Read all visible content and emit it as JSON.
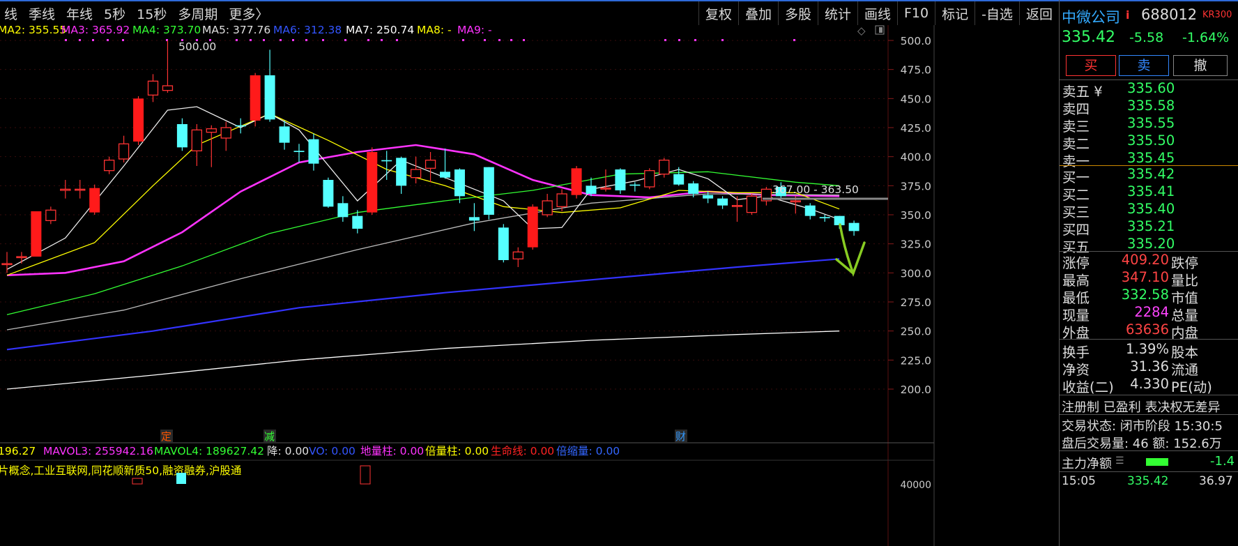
{
  "left_tabs": [
    "线",
    "季线",
    "年线",
    "5秒",
    "15秒",
    "多周期",
    "更多〉"
  ],
  "toolbar": [
    "复权",
    "叠加",
    "多股",
    "统计",
    "画线",
    "F10",
    "标记",
    "-自选",
    "返回"
  ],
  "ma_legend": [
    {
      "text": "MA2: 355.55",
      "color": "#ffff00"
    },
    {
      "text": "MA3: 365.92",
      "color": "#ff33ff"
    },
    {
      "text": "MA4: 373.70",
      "color": "#33ff33"
    },
    {
      "text": "MA5: 377.76",
      "color": "#e0e0e0"
    },
    {
      "text": "MA6: 312.38",
      "color": "#3355ff"
    },
    {
      "text": "MA7: 250.74",
      "color": "#ffffff"
    },
    {
      "text": "MA8: -",
      "color": "#ffff00"
    },
    {
      "text": "MA9: -",
      "color": "#ff33ff"
    }
  ],
  "y_ticks": [
    "500.0",
    "475.0",
    "450.0",
    "425.0",
    "400.0",
    "375.0",
    "350.0",
    "325.0",
    "300.0",
    "275.0",
    "250.0",
    "225.0",
    "200.0"
  ],
  "high_label": "500.00",
  "range_label": "367.00 - 363.50",
  "event_markers": [
    {
      "text": "定",
      "color": "#ff5500"
    },
    {
      "text": "减",
      "color": "#33ff33"
    },
    {
      "text": "财",
      "color": "#3399ff"
    }
  ],
  "vol_legend": [
    {
      "text": "196.27",
      "color": "#ffff00"
    },
    {
      "text": "MAVOL3: 255942.16",
      "color": "#ff33ff"
    },
    {
      "text": "MAVOL4: 189627.42",
      "color": "#33ff33"
    },
    {
      "text": "降: 0.00",
      "color": "#e0e0e0"
    },
    {
      "text": "VO: 0.00",
      "color": "#3355ff"
    },
    {
      "text": "地量柱: 0.00",
      "color": "#ff33ff"
    },
    {
      "text": "倍量柱: 0.00",
      "color": "#ffff00"
    },
    {
      "text": "生命线: 0.00",
      "color": "#ff2222"
    },
    {
      "text": "倍缩量: 0.00",
      "color": "#3366ff"
    }
  ],
  "concepts": "片概念,工业互联网,同花顺新质50,融资融券,沪股通",
  "vol_axis_label": "40000",
  "chart_data": {
    "type": "candlestick",
    "ylim": [
      200,
      500
    ],
    "candles": [
      {
        "o": 308,
        "c": 308,
        "h": 318,
        "l": 300
      },
      {
        "o": 314,
        "c": 314,
        "h": 318,
        "l": 308
      },
      {
        "o": 314,
        "c": 353,
        "h": 353,
        "l": 314
      },
      {
        "o": 345,
        "c": 354,
        "h": 357,
        "l": 342
      },
      {
        "o": 371,
        "c": 372,
        "h": 380,
        "l": 364
      },
      {
        "o": 372,
        "c": 372,
        "h": 380,
        "l": 364
      },
      {
        "o": 352,
        "c": 373,
        "h": 376,
        "l": 350
      },
      {
        "o": 388,
        "c": 397,
        "h": 400,
        "l": 385
      },
      {
        "o": 398,
        "c": 411,
        "h": 418,
        "l": 395
      },
      {
        "o": 413,
        "c": 450,
        "h": 452,
        "l": 410
      },
      {
        "o": 453,
        "c": 465,
        "h": 471,
        "l": 447
      },
      {
        "o": 457,
        "c": 461,
        "h": 500,
        "l": 455
      },
      {
        "o": 428,
        "c": 408,
        "h": 433,
        "l": 405
      },
      {
        "o": 405,
        "c": 423,
        "h": 428,
        "l": 392
      },
      {
        "o": 421,
        "c": 424,
        "h": 427,
        "l": 391
      },
      {
        "o": 416,
        "c": 425,
        "h": 430,
        "l": 405
      },
      {
        "o": 427,
        "c": 426,
        "h": 433,
        "l": 420
      },
      {
        "o": 431,
        "c": 470,
        "h": 472,
        "l": 426
      },
      {
        "o": 470,
        "c": 432,
        "h": 492,
        "l": 430
      },
      {
        "o": 426,
        "c": 412,
        "h": 431,
        "l": 406
      },
      {
        "o": 405,
        "c": 404,
        "h": 411,
        "l": 395
      },
      {
        "o": 415,
        "c": 394,
        "h": 420,
        "l": 388
      },
      {
        "o": 380,
        "c": 357,
        "h": 382,
        "l": 356
      },
      {
        "o": 360,
        "c": 348,
        "h": 366,
        "l": 344
      },
      {
        "o": 349,
        "c": 338,
        "h": 354,
        "l": 334
      },
      {
        "o": 352,
        "c": 404,
        "h": 408,
        "l": 350
      },
      {
        "o": 397,
        "c": 396,
        "h": 405,
        "l": 380
      },
      {
        "o": 399,
        "c": 375,
        "h": 400,
        "l": 368
      },
      {
        "o": 382,
        "c": 389,
        "h": 400,
        "l": 377
      },
      {
        "o": 390,
        "c": 397,
        "h": 404,
        "l": 378
      },
      {
        "o": 387,
        "c": 382,
        "h": 407,
        "l": 381
      },
      {
        "o": 389,
        "c": 366,
        "h": 390,
        "l": 360
      },
      {
        "o": 348,
        "c": 345,
        "h": 360,
        "l": 336
      },
      {
        "o": 391,
        "c": 350,
        "h": 391,
        "l": 346
      },
      {
        "o": 339,
        "c": 311,
        "h": 342,
        "l": 309
      },
      {
        "o": 312,
        "c": 318,
        "h": 322,
        "l": 305
      },
      {
        "o": 322,
        "c": 357,
        "h": 359,
        "l": 320
      },
      {
        "o": 350,
        "c": 362,
        "h": 368,
        "l": 348
      },
      {
        "o": 357,
        "c": 368,
        "h": 372,
        "l": 353
      },
      {
        "o": 367,
        "c": 390,
        "h": 392,
        "l": 364
      },
      {
        "o": 375,
        "c": 368,
        "h": 382,
        "l": 366
      },
      {
        "o": 373,
        "c": 373,
        "h": 389,
        "l": 370
      },
      {
        "o": 389,
        "c": 371,
        "h": 390,
        "l": 368
      },
      {
        "o": 376,
        "c": 375,
        "h": 378,
        "l": 370
      },
      {
        "o": 374,
        "c": 388,
        "h": 390,
        "l": 372
      },
      {
        "o": 385,
        "c": 397,
        "h": 399,
        "l": 382
      },
      {
        "o": 385,
        "c": 376,
        "h": 391,
        "l": 375
      },
      {
        "o": 377,
        "c": 368,
        "h": 379,
        "l": 365
      },
      {
        "o": 367,
        "c": 364,
        "h": 370,
        "l": 360
      },
      {
        "o": 364,
        "c": 358,
        "h": 366,
        "l": 355
      },
      {
        "o": 358,
        "c": 358,
        "h": 366,
        "l": 344
      },
      {
        "o": 352,
        "c": 366,
        "h": 368,
        "l": 350
      },
      {
        "o": 362,
        "c": 372,
        "h": 374,
        "l": 358
      },
      {
        "o": 374,
        "c": 366,
        "h": 378,
        "l": 364
      },
      {
        "o": 362,
        "c": 362,
        "h": 366,
        "l": 351
      },
      {
        "o": 358,
        "c": 349,
        "h": 360,
        "l": 346
      },
      {
        "o": 348,
        "c": 347,
        "h": 350,
        "l": 344
      },
      {
        "o": 349,
        "c": 341,
        "h": 349,
        "l": 338
      },
      {
        "o": 343,
        "c": 336,
        "h": 345,
        "l": 332
      }
    ],
    "ma_lines": [
      {
        "name": "MA6",
        "color": "#3333ff",
        "values": [
          [
            0,
            234
          ],
          [
            10,
            250
          ],
          [
            20,
            270
          ],
          [
            30,
            283
          ],
          [
            40,
            294
          ],
          [
            50,
            305
          ],
          [
            57,
            312
          ]
        ]
      },
      {
        "name": "MA7",
        "color": "#ffffff",
        "values": [
          [
            0,
            200
          ],
          [
            10,
            212
          ],
          [
            20,
            225
          ],
          [
            30,
            235
          ],
          [
            40,
            242
          ],
          [
            50,
            247
          ],
          [
            57,
            250
          ]
        ]
      },
      {
        "name": "MA3",
        "color": "#ff33ff",
        "values": [
          [
            0,
            298
          ],
          [
            4,
            300
          ],
          [
            8,
            310
          ],
          [
            12,
            335
          ],
          [
            16,
            370
          ],
          [
            20,
            395
          ],
          [
            24,
            404
          ],
          [
            28,
            410
          ],
          [
            32,
            402
          ],
          [
            36,
            380
          ],
          [
            40,
            367
          ],
          [
            44,
            365
          ],
          [
            48,
            370
          ],
          [
            52,
            367
          ],
          [
            57,
            366
          ]
        ]
      },
      {
        "name": "MA4",
        "color": "#33ff33",
        "values": [
          [
            0,
            264
          ],
          [
            6,
            282
          ],
          [
            12,
            306
          ],
          [
            18,
            334
          ],
          [
            24,
            352
          ],
          [
            30,
            362
          ],
          [
            36,
            371
          ],
          [
            42,
            385
          ],
          [
            48,
            387
          ],
          [
            54,
            378
          ],
          [
            57,
            375
          ]
        ]
      },
      {
        "name": "MA5",
        "color": "#bbbbbb",
        "values": [
          [
            0,
            251
          ],
          [
            8,
            268
          ],
          [
            16,
            295
          ],
          [
            24,
            320
          ],
          [
            32,
            343
          ],
          [
            40,
            360
          ],
          [
            48,
            368
          ],
          [
            57,
            367
          ]
        ]
      },
      {
        "name": "MA2",
        "color": "#ffff00",
        "values": [
          [
            0,
            298
          ],
          [
            6,
            326
          ],
          [
            10,
            375
          ],
          [
            13,
            410
          ],
          [
            18,
            437
          ],
          [
            22,
            414
          ],
          [
            26,
            389
          ],
          [
            30,
            375
          ],
          [
            34,
            357
          ],
          [
            38,
            352
          ],
          [
            42,
            356
          ],
          [
            46,
            371
          ],
          [
            50,
            369
          ],
          [
            54,
            369
          ],
          [
            57,
            355
          ]
        ]
      },
      {
        "name": "MA1",
        "color": "#eeeeee",
        "values": [
          [
            0,
            303
          ],
          [
            4,
            330
          ],
          [
            8,
            392
          ],
          [
            11,
            440
          ],
          [
            13,
            443
          ],
          [
            16,
            425
          ],
          [
            18,
            437
          ],
          [
            20,
            423
          ],
          [
            24,
            362
          ],
          [
            27,
            397
          ],
          [
            30,
            382
          ],
          [
            34,
            362
          ],
          [
            36,
            338
          ],
          [
            38,
            339
          ],
          [
            40,
            372
          ],
          [
            43,
            379
          ],
          [
            46,
            389
          ],
          [
            48,
            381
          ],
          [
            50,
            363
          ],
          [
            52,
            366
          ],
          [
            55,
            355
          ],
          [
            57,
            346
          ]
        ]
      }
    ]
  },
  "stock": {
    "name": "中微公司",
    "flag": "i",
    "code": "688012",
    "tag": "KR300",
    "price": "335.42",
    "change": "-5.58",
    "pct": "-1.64%"
  },
  "buttons": {
    "buy": "买",
    "sell": "卖",
    "cancel": "撤"
  },
  "asks": [
    {
      "label": "卖五",
      "extra": "¥",
      "price": "335.60"
    },
    {
      "label": "卖四",
      "extra": "",
      "price": "335.58"
    },
    {
      "label": "卖三",
      "extra": "",
      "price": "335.55"
    },
    {
      "label": "卖二",
      "extra": "",
      "price": "335.50"
    },
    {
      "label": "卖一",
      "extra": "",
      "price": "335.45"
    }
  ],
  "bids": [
    {
      "label": "买一",
      "price": "335.42"
    },
    {
      "label": "买二",
      "price": "335.41"
    },
    {
      "label": "买三",
      "price": "335.40"
    },
    {
      "label": "买四",
      "price": "335.21"
    },
    {
      "label": "买五",
      "price": "335.20"
    }
  ],
  "stats": [
    {
      "l": "涨停",
      "v": "409.20",
      "c": "#ff4444",
      "r": "跌停"
    },
    {
      "l": "最高",
      "v": "347.10",
      "c": "#ff4444",
      "r": "量比"
    },
    {
      "l": "最低",
      "v": "332.58",
      "c": "#33ff66",
      "r": "市值"
    },
    {
      "l": "现量",
      "v": "2284",
      "c": "#ff44ff",
      "r": "总量"
    },
    {
      "l": "外盘",
      "v": "63636",
      "c": "#ff4444",
      "r": "内盘"
    }
  ],
  "stats2": [
    {
      "l": "换手",
      "v": "1.39%",
      "r": "股本"
    },
    {
      "l": "净资",
      "v": "31.36",
      "r": "流通"
    },
    {
      "l": "收益(二)",
      "v": "4.330",
      "r": "PE(动)"
    }
  ],
  "tags_line": "注册制 已盈利 表决权无差异",
  "trade_status": "交易状态: 闭市阶段 15:30:5",
  "after_hours": "盘后交易量: 46  额: 152.6万",
  "main_flow": {
    "label": "主力净额",
    "value": "-1.4"
  },
  "last_tick": {
    "time": "15:05",
    "price": "335.42",
    "extra": "36.97"
  }
}
